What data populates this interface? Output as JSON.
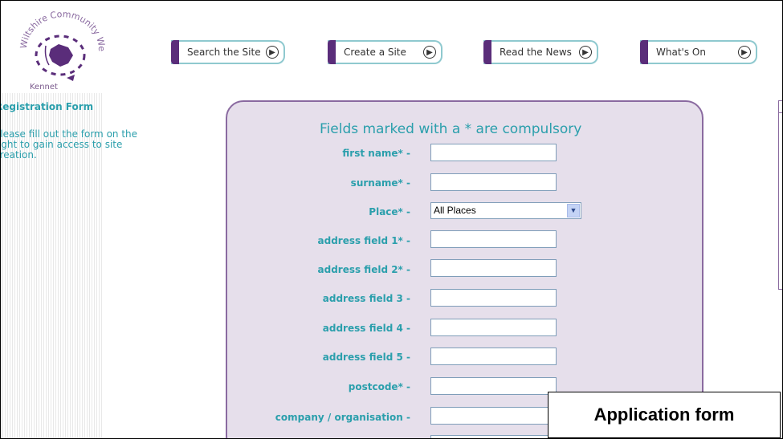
{
  "logo": {
    "site_name": "Wiltshire Community Web",
    "area": "Kennet"
  },
  "nav": [
    {
      "label": "Search the Site"
    },
    {
      "label": "Create a Site"
    },
    {
      "label": "Read the News"
    },
    {
      "label": "What's On"
    }
  ],
  "sidebar": {
    "title": "Registration Form",
    "text": "Please fill out the form on the right to gain access to site creation."
  },
  "form": {
    "heading": "Fields marked with a * are compulsory",
    "fields": [
      {
        "label": "first name* -",
        "value": ""
      },
      {
        "label": "surname* -",
        "value": ""
      },
      {
        "label": "Place* -",
        "value": "All Places"
      },
      {
        "label": "address field 1* -",
        "value": ""
      },
      {
        "label": "address field 2* -",
        "value": ""
      },
      {
        "label": "address field 3 -",
        "value": ""
      },
      {
        "label": "address field 4 -",
        "value": ""
      },
      {
        "label": "address field 5 -",
        "value": ""
      },
      {
        "label": "postcode* -",
        "value": ""
      },
      {
        "label": "company / organisation -",
        "value": ""
      }
    ]
  },
  "caption": "Application form",
  "colors": {
    "accent": "#2b9fac",
    "purple": "#5a2d7a",
    "panel": "#e6dfeb"
  }
}
